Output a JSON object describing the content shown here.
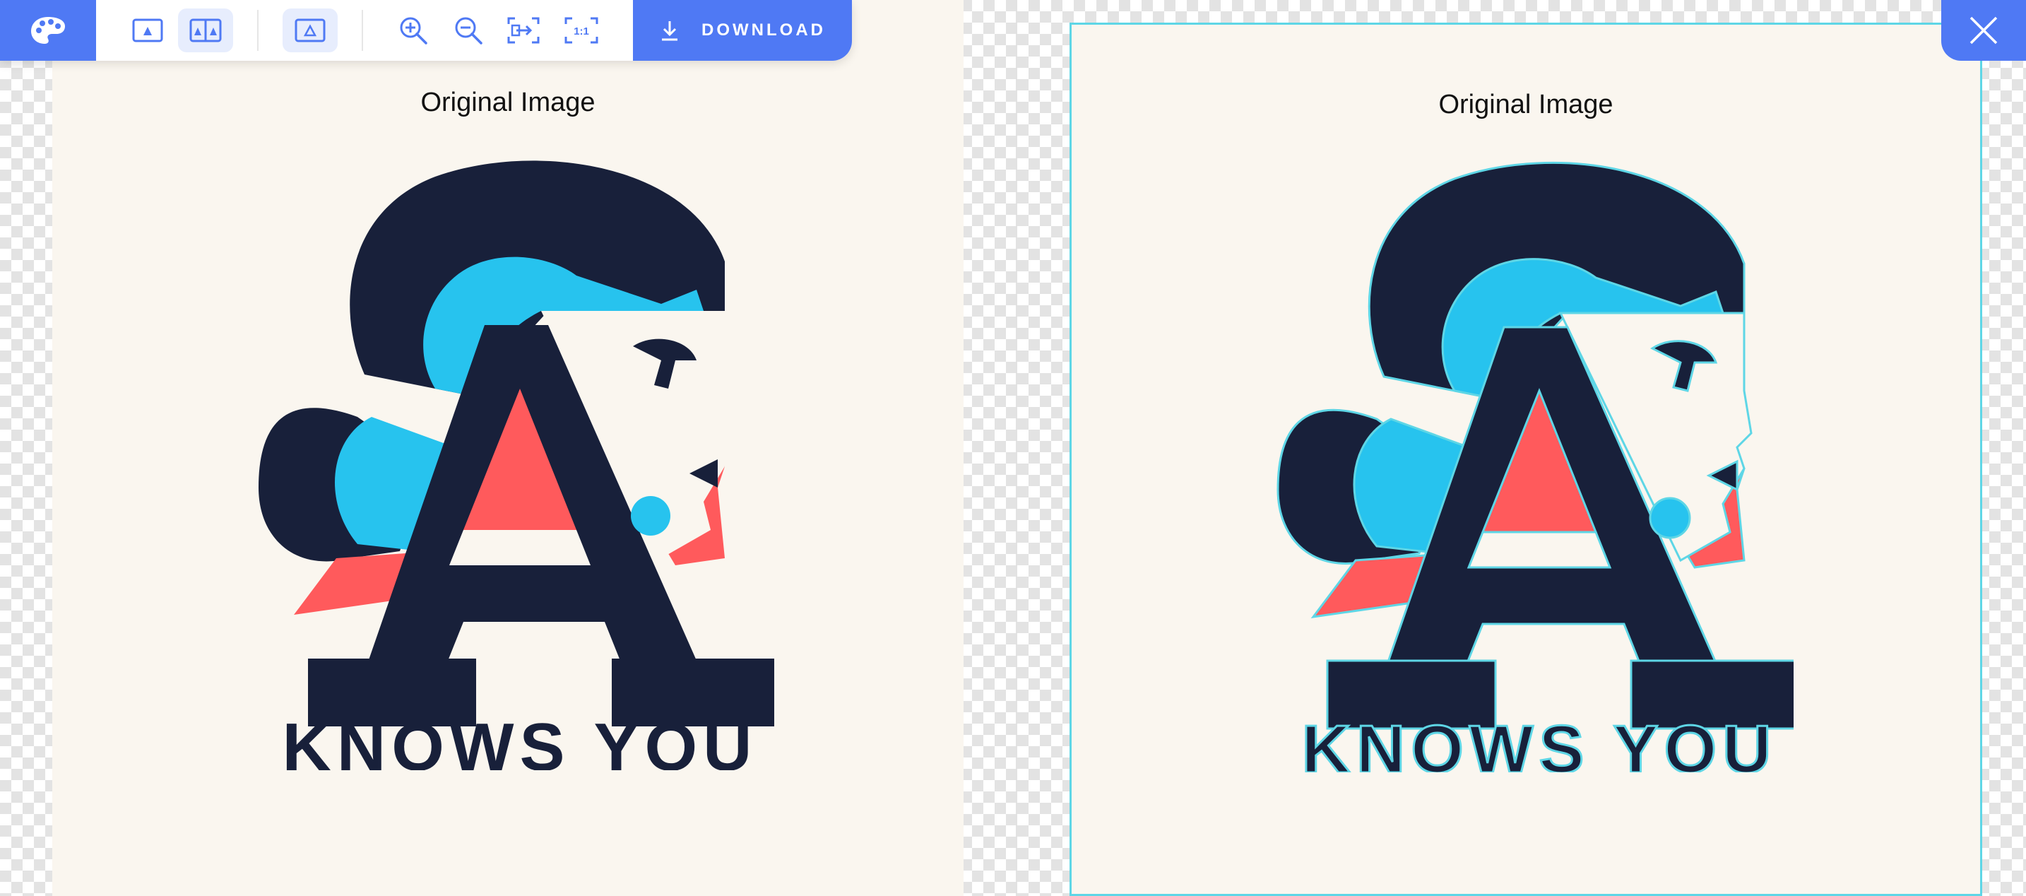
{
  "toolbar": {
    "logo_icon": "palette-icon",
    "view_buttons": [
      {
        "icon": "single-image-icon",
        "active": false
      },
      {
        "icon": "side-by-side-icon",
        "active": true
      }
    ],
    "outline_button": {
      "icon": "outline-triangle-icon",
      "active": true
    },
    "zoom_in_icon": "zoom-in-icon",
    "zoom_out_icon": "zoom-out-icon",
    "fit_icon": "fit-screen-icon",
    "actual_size_label": "1:1",
    "download_icon": "download-icon",
    "download_label": "DOWNLOAD",
    "accent_color": "#4f79f4"
  },
  "close_button": {
    "icon": "close-icon"
  },
  "panels": [
    {
      "label": "Original Image",
      "outlined": false
    },
    {
      "label": "Original Image",
      "outlined": true,
      "outline_color": "#5ed6e6"
    }
  ],
  "artwork": {
    "text": "KNOWS YOU",
    "colors": {
      "navy": "#18203a",
      "cyan": "#27c3ee",
      "coral": "#ff5a5c",
      "cream": "#faf6ef"
    }
  }
}
